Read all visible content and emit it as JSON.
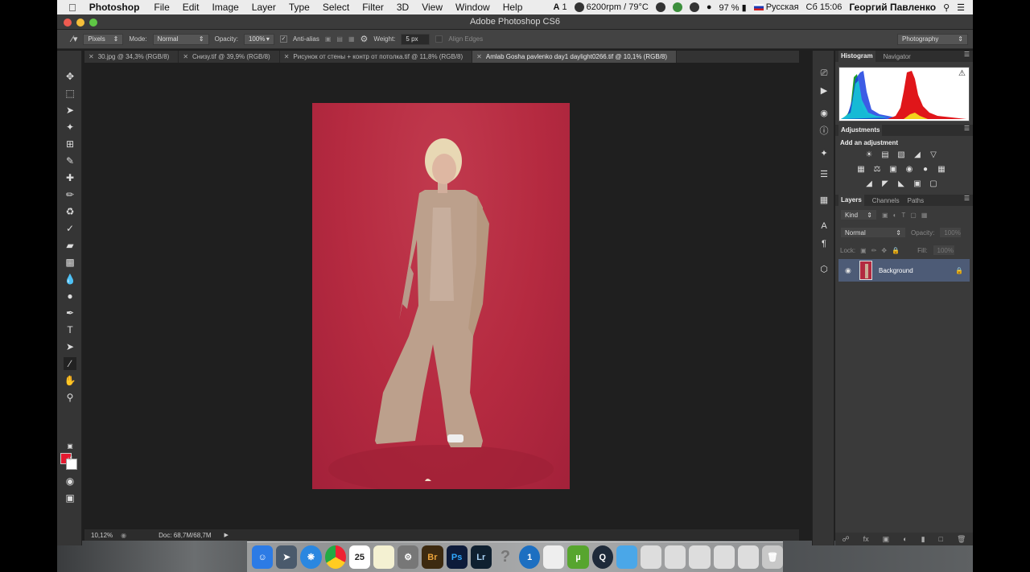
{
  "menubar": {
    "app_name": "Photoshop",
    "menus": [
      "File",
      "Edit",
      "Image",
      "Layer",
      "Type",
      "Select",
      "Filter",
      "3D",
      "View",
      "Window",
      "Help"
    ],
    "status_adobe": "1",
    "status_fan": "6200rpm / 79°C",
    "battery": "97 %",
    "input_source": "Русская",
    "clock": "Сб 15:06",
    "user": "Георгий Павленко"
  },
  "window": {
    "title": "Adobe Photoshop CS6"
  },
  "options": {
    "mode_pixels": "Pixels",
    "mode_label": "Mode:",
    "mode_value": "Normal",
    "opacity_label": "Opacity:",
    "opacity_value": "100%",
    "antialias_label": "Anti-alias",
    "weight_label": "Weight:",
    "weight_value": "5 px",
    "align_edges_label": "Align Edges",
    "workspace": "Photography"
  },
  "tabs": [
    "30.jpg @ 34,3% (RGB/8)",
    "Снизу.tif @ 39,9% (RGB/8)",
    "Рисунок от стены + контр от потолка.tif @ 11,8% (RGB/8)",
    "Amlab Gosha pavlenko day1 daylight0266.tif @ 10,1% (RGB/8)"
  ],
  "status": {
    "zoom": "10,12%",
    "doc": "Doc: 68,7M/68,7M"
  },
  "panels": {
    "histogram_tab": "Histogram",
    "navigator_tab": "Navigator",
    "adjustments_tab": "Adjustments",
    "add_adjustment": "Add an adjustment",
    "layers_tab": "Layers",
    "channels_tab": "Channels",
    "paths_tab": "Paths",
    "kind_filter": "Kind",
    "blend_mode": "Normal",
    "opacity_label": "Opacity:",
    "opacity_value": "100%",
    "lock_label": "Lock:",
    "fill_label": "Fill:",
    "fill_value": "100%",
    "layer_name": "Background"
  },
  "dock": {
    "calendar_day": "25",
    "br": "Br",
    "ps": "Ps",
    "lr": "Lr"
  },
  "colors": {
    "foreground": "#e4192f",
    "background": "#ffffff",
    "backdrop": "#b52a40"
  }
}
